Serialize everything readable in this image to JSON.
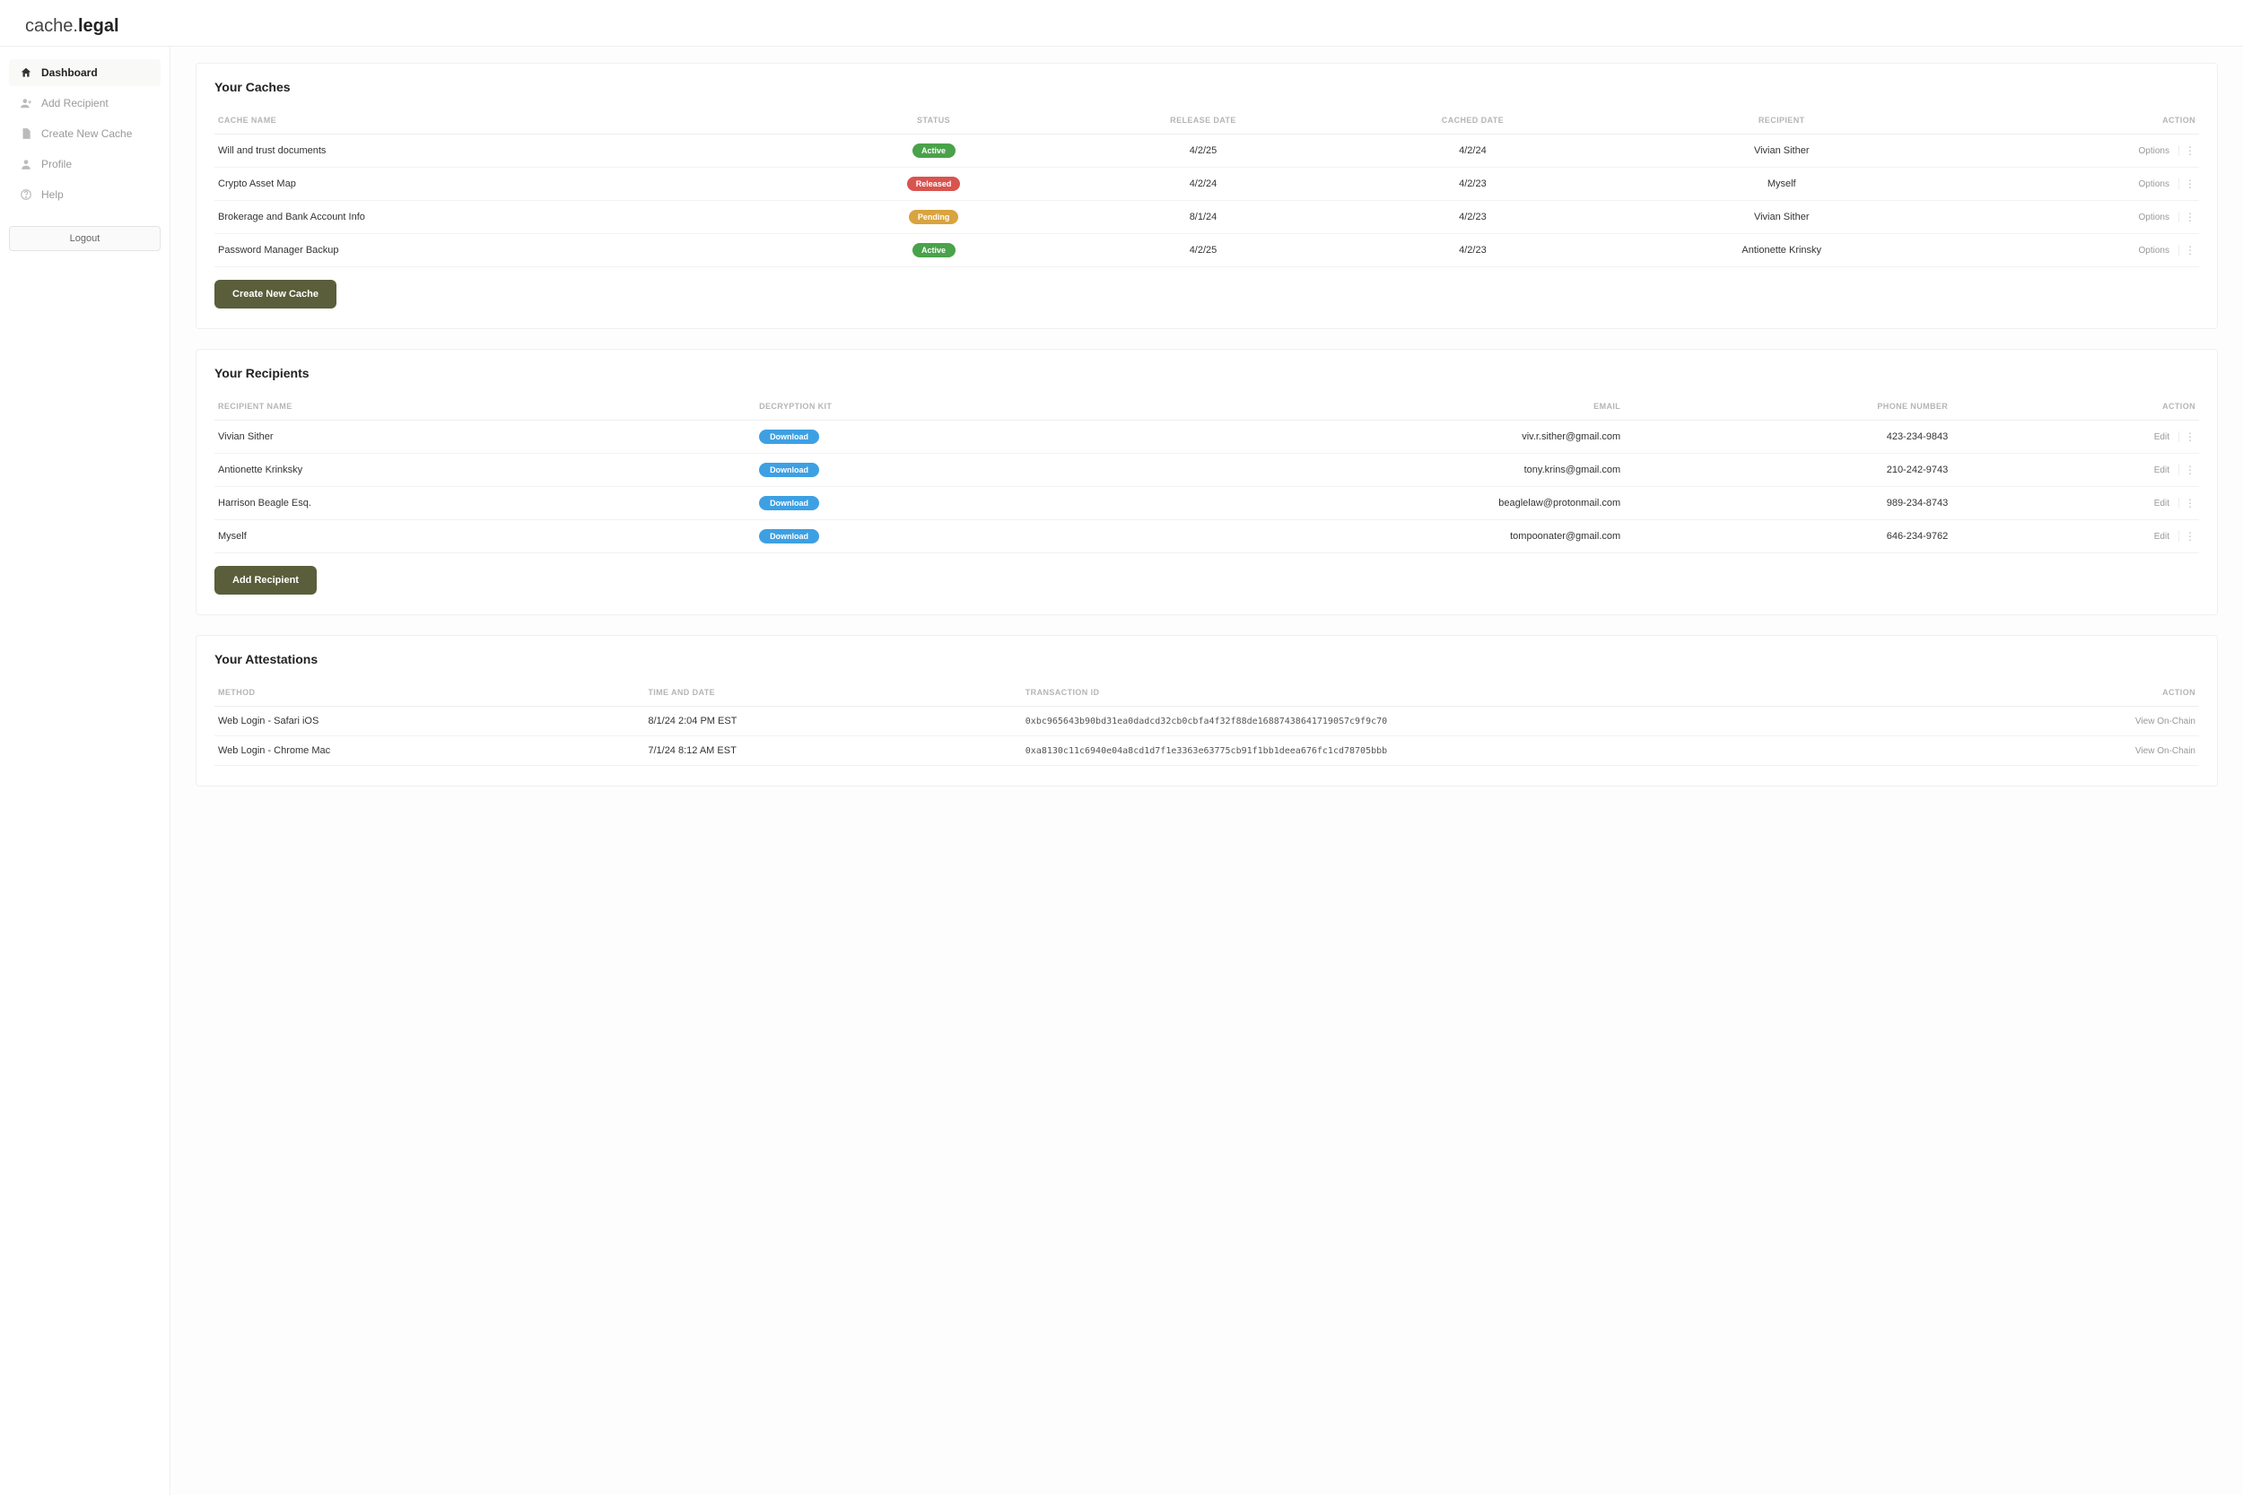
{
  "brand": {
    "part1": "cache.",
    "part2": "legal"
  },
  "sidebar": {
    "items": [
      {
        "id": "dashboard",
        "label": "Dashboard",
        "active": true
      },
      {
        "id": "add-recipient",
        "label": "Add Recipient",
        "active": false
      },
      {
        "id": "create-cache",
        "label": "Create New Cache",
        "active": false
      },
      {
        "id": "profile",
        "label": "Profile",
        "active": false
      },
      {
        "id": "help",
        "label": "Help",
        "active": false
      }
    ],
    "logout": "Logout"
  },
  "caches": {
    "title": "Your Caches",
    "headers": [
      "CACHE NAME",
      "STATUS",
      "RELEASE DATE",
      "CACHED DATE",
      "RECIPIENT",
      "ACTION"
    ],
    "rows": [
      {
        "name": "Will and trust documents",
        "status": "Active",
        "release": "4/2/25",
        "cached": "4/2/24",
        "recipient": "Vivian Sither",
        "action": "Options"
      },
      {
        "name": "Crypto Asset Map",
        "status": "Released",
        "release": "4/2/24",
        "cached": "4/2/23",
        "recipient": "Myself",
        "action": "Options"
      },
      {
        "name": "Brokerage and Bank Account Info",
        "status": "Pending",
        "release": "8/1/24",
        "cached": "4/2/23",
        "recipient": "Vivian Sither",
        "action": "Options"
      },
      {
        "name": "Password Manager Backup",
        "status": "Active",
        "release": "4/2/25",
        "cached": "4/2/23",
        "recipient": "Antionette Krinsky",
        "action": "Options"
      }
    ],
    "button": "Create New Cache"
  },
  "recipients": {
    "title": "Your Recipients",
    "headers": [
      "RECIPIENT NAME",
      "DECRYPTION KIT",
      "EMAIL",
      "PHONE NUMBER",
      "ACTION"
    ],
    "rows": [
      {
        "name": "Vivian Sither",
        "kit": "Download",
        "email": "viv.r.sither@gmail.com",
        "phone": "423-234-9843",
        "action": "Edit"
      },
      {
        "name": "Antionette Krinksky",
        "kit": "Download",
        "email": "tony.krins@gmail.com",
        "phone": "210-242-9743",
        "action": "Edit"
      },
      {
        "name": "Harrison Beagle Esq.",
        "kit": "Download",
        "email": "beaglelaw@protonmail.com",
        "phone": "989-234-8743",
        "action": "Edit"
      },
      {
        "name": "Myself",
        "kit": "Download",
        "email": "tompoonater@gmail.com",
        "phone": "646-234-9762",
        "action": "Edit"
      }
    ],
    "button": "Add Recipient"
  },
  "attestations": {
    "title": "Your Attestations",
    "headers": [
      "METHOD",
      "TIME AND DATE",
      "TRANSACTION ID",
      "ACTION"
    ],
    "rows": [
      {
        "method": "Web Login - Safari iOS",
        "time": "8/1/24 2:04 PM EST",
        "tx": "0xbc965643b90bd31ea0dadcd32cb0cbfa4f32f88de168874386417190S7c9f9c70",
        "action": "View On-Chain"
      },
      {
        "method": "Web Login - Chrome Mac",
        "time": "7/1/24 8:12 AM EST",
        "tx": "0xa8130c11c6940e04a8cd1d7f1e3363e63775cb91f1bb1deea676fc1cd78705bbb",
        "action": "View On-Chain"
      }
    ]
  },
  "status_colors": {
    "Active": "#4aa24a",
    "Released": "#d9534f",
    "Pending": "#d9a33f"
  }
}
